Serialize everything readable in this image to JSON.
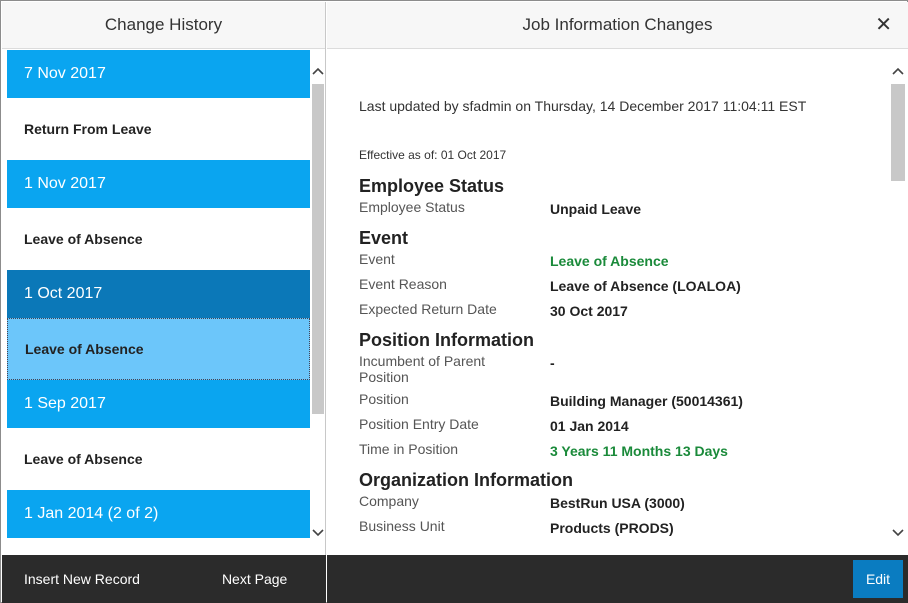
{
  "left_panel": {
    "title": "Change History",
    "records": [
      {
        "date": "7 Nov 2017",
        "event": "Return From Leave",
        "selected": false
      },
      {
        "date": "1 Nov 2017",
        "event": "Leave of Absence",
        "selected": false
      },
      {
        "date": "1 Oct 2017",
        "event": "Leave of Absence",
        "selected": true
      },
      {
        "date": "1 Sep 2017",
        "event": "Leave of Absence",
        "selected": false
      },
      {
        "date": "1 Jan 2014 (2 of 2)",
        "event": "",
        "selected": false
      }
    ],
    "footer": {
      "insert_label": "Insert New Record",
      "next_label": "Next Page"
    }
  },
  "right_panel": {
    "title": "Job Information Changes",
    "last_updated": "Last updated by sfadmin on Thursday, 14 December 2017 11:04:11 EST",
    "effective": "Effective as of: 01 Oct 2017",
    "sections": [
      {
        "title": "Employee Status",
        "fields": [
          {
            "label": "Employee Status",
            "value": "Unpaid Leave",
            "highlight": false
          }
        ]
      },
      {
        "title": "Event",
        "fields": [
          {
            "label": "Event",
            "value": "Leave of Absence",
            "highlight": true
          },
          {
            "label": "Event Reason",
            "value": "Leave of Absence (LOALOA)",
            "highlight": false
          },
          {
            "label": "Expected Return Date",
            "value": "30 Oct 2017",
            "highlight": false
          }
        ]
      },
      {
        "title": "Position Information",
        "fields": [
          {
            "label": "Incumbent of Parent Position",
            "value": "-",
            "highlight": false
          },
          {
            "label": "Position",
            "value": "Building Manager (50014361)",
            "highlight": false
          },
          {
            "label": "Position Entry Date",
            "value": "01 Jan 2014",
            "highlight": false
          },
          {
            "label": "Time in Position",
            "value": "3 Years 11 Months 13 Days",
            "highlight": true
          }
        ]
      },
      {
        "title": "Organization Information",
        "fields": [
          {
            "label": "Company",
            "value": "BestRun USA (3000)",
            "highlight": false
          },
          {
            "label": "Business Unit",
            "value": "Products (PRODS)",
            "highlight": false
          }
        ]
      }
    ],
    "footer": {
      "edit_label": "Edit"
    }
  },
  "icons": {
    "close": "close-icon",
    "scroll_up": "chevron-up-icon",
    "scroll_down": "chevron-down-icon"
  },
  "colors": {
    "date_row": "#0aa5f0",
    "date_row_selected": "#0b78b8",
    "event_selected": "#6cc6fa",
    "highlight_text": "#1a8a3a",
    "footer": "#2b2b2b",
    "edit_button": "#0a7cc1"
  }
}
